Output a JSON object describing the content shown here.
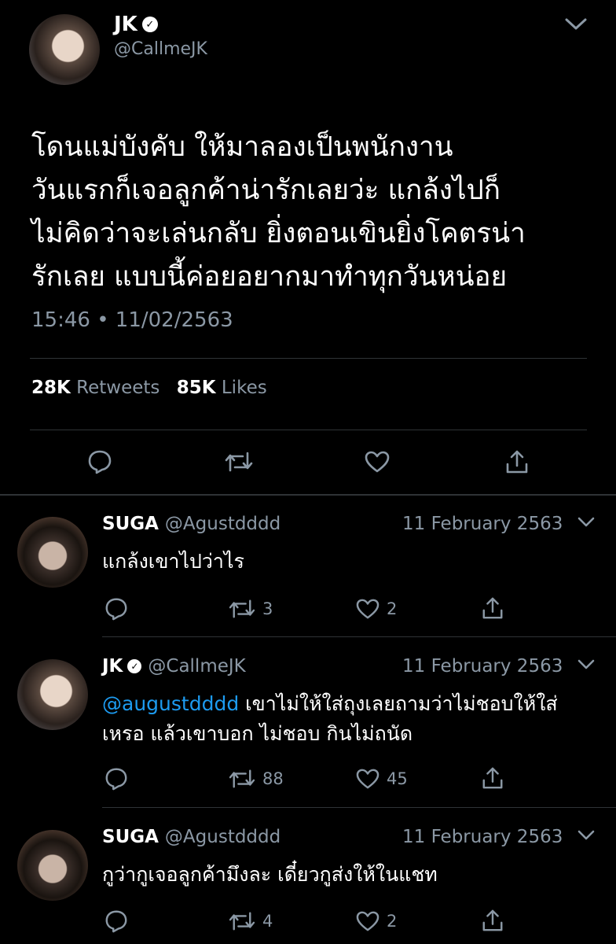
{
  "main_tweet": {
    "name": "JK",
    "verified_icon": "verified-check-icon",
    "handle": "@CallmeJK",
    "text": "โดนแม่บังคับ ให้มาลองเป็นพนักงาน\nวันแรกก็เจอลูกค้าน่ารักเลยว่ะ แกล้งไปก็\nไม่คิดว่าจะเล่นกลับ ยิ่งตอนเขินยิ่งโคตรน่า\nรักเลย แบบนี้ค่อยอยากมาทำทุกวันหน่อย",
    "timestamp": "15:46 • 11/02/2563",
    "retweets_count": "28K",
    "retweets_label": "Retweets",
    "likes_count": "85K",
    "likes_label": "Likes",
    "actions": [
      "reply-icon",
      "retweet-icon",
      "like-icon",
      "share-icon"
    ]
  },
  "replies": [
    {
      "name": "SUGA",
      "handle": "@Agustdddd",
      "date": "11 February 2563",
      "mention": "",
      "text": "แกล้งเขาไปว่าไร",
      "retweets": "3",
      "likes": "2"
    },
    {
      "name": "JK",
      "handle": "@CallmeJK",
      "date": "11 February 2563",
      "mention": "@augustdddd",
      "text": " เขาไม่ให้ใส่ถุงเลยถามว่าไม่ชอบให้ใส่เหรอ แล้วเขาบอก ไม่ชอบ กินไม่ถนัด",
      "retweets": "88",
      "likes": "45"
    },
    {
      "name": "SUGA",
      "handle": "@Agustdddd",
      "date": "11 February 2563",
      "mention": "",
      "text": "กูว่ากูเจอลูกค้ามึงละ เดี๋ยวกูส่งให้ในแชท",
      "retweets": "4",
      "likes": "2"
    }
  ],
  "colors": {
    "background": "#000000",
    "secondary_text": "#8b98a5",
    "mention": "#1d9bf0",
    "divider": "#2f3336"
  }
}
